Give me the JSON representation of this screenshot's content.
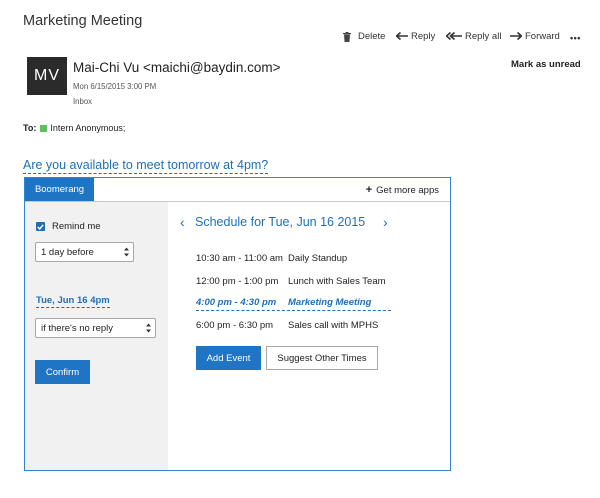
{
  "email": {
    "subject": "Marketing Meeting",
    "avatar_initials": "MV",
    "sender": "Mai-Chi Vu <maichi@baydin.com>",
    "sent": "Mon 6/15/2015 3:00 PM",
    "folder": "Inbox",
    "mark_unread": "Mark as unread",
    "to_label": "To:",
    "recipient": "Intern Anonymous;",
    "question": "Are you available to meet tomorrow at 4pm?"
  },
  "toolbar": {
    "delete": "Delete",
    "reply": "Reply",
    "reply_all": "Reply all",
    "forward": "Forward",
    "more": "•••"
  },
  "boomerang": {
    "tab": "Boomerang",
    "get_more_apps": "Get more apps",
    "get_more_apps_prefix": "+",
    "remind_me": "Remind me",
    "remind_checked": true,
    "interval": "1 day before",
    "remind_date": "Tue, Jun 16 4pm",
    "condition": "if there's no reply",
    "confirm": "Confirm",
    "schedule_title": "Schedule for Tue, Jun 16 2015",
    "prev_arrow": "‹",
    "next_arrow": "›",
    "events": [
      {
        "time": "10:30 am - 11:00 am",
        "title": "Daily Standup"
      },
      {
        "time": "12:00 pm - 1:00 pm",
        "title": "Lunch with Sales Team"
      },
      {
        "time": "4:00 pm - 4:30 pm",
        "title": "Marketing Meeting",
        "proposed": true
      },
      {
        "time": "6:00 pm - 6:30 pm",
        "title": "Sales call with MPHS"
      }
    ],
    "add_event": "Add Event",
    "suggest_times": "Suggest Other Times"
  },
  "colors": {
    "accent": "#1f74c3",
    "link": "#1f6fb5",
    "presence": "#5cc15c"
  }
}
